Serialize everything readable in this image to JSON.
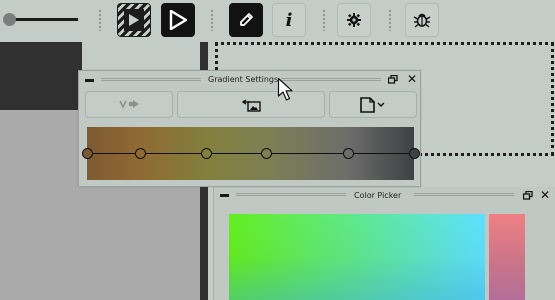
{
  "toolbar": {
    "slider_value": 0.0,
    "buttons": [
      {
        "icon": "play-striped-icon",
        "state": "pressed"
      },
      {
        "icon": "play-icon",
        "state": "active"
      },
      {
        "icon": "pencil-icon",
        "state": "active"
      },
      {
        "icon": "info-icon",
        "label": "i"
      },
      {
        "icon": "gear-icon"
      },
      {
        "icon": "bug-icon"
      }
    ]
  },
  "gradient_settings": {
    "title": "Gradient Settings",
    "buttons": [
      {
        "icon": "apply-gradient-icon",
        "enabled": false
      },
      {
        "icon": "gradient-from-image-icon",
        "enabled": true
      },
      {
        "icon": "file-menu-icon",
        "enabled": true
      }
    ],
    "stops": [
      {
        "position": 0.0,
        "color": "#7e5a33"
      },
      {
        "position": 0.165,
        "color": "#8f6a33"
      },
      {
        "position": 0.365,
        "color": "#83803e"
      },
      {
        "position": 0.55,
        "color": "#7e8054"
      },
      {
        "position": 0.8,
        "color": "#6c6d6b"
      },
      {
        "position": 1.0,
        "color": "#3e4143"
      }
    ]
  },
  "color_picker": {
    "title": "Color Picker"
  },
  "colors": {
    "background": "#c4ccc8",
    "dark": "#303030",
    "canvas_gray": "#aaaaaa"
  }
}
